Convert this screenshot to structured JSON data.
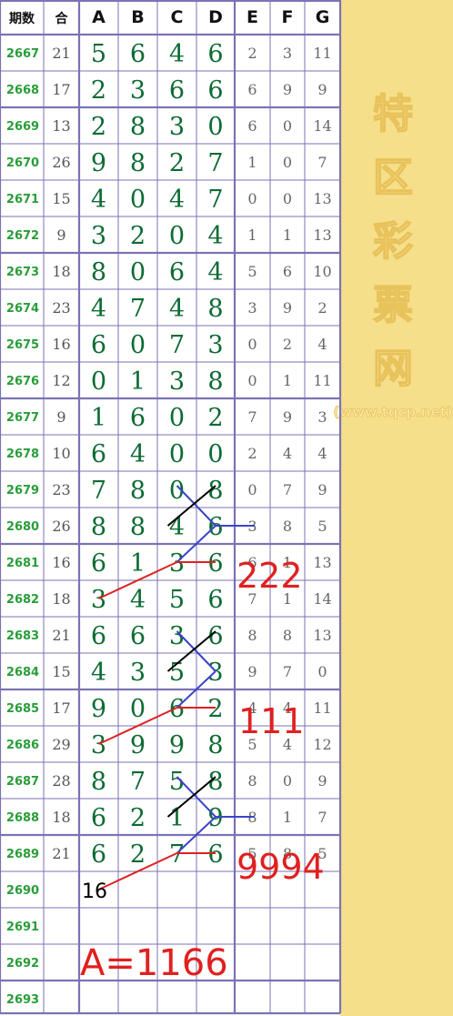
{
  "chart_data": {
    "type": "table",
    "columns": [
      "期数",
      "合",
      "A",
      "B",
      "C",
      "D",
      "E",
      "F",
      "G"
    ],
    "rows": [
      [
        "2667",
        "21",
        "5",
        "6",
        "4",
        "6",
        "2",
        "3",
        "11"
      ],
      [
        "2668",
        "17",
        "2",
        "3",
        "6",
        "6",
        "6",
        "9",
        "9"
      ],
      [
        "2669",
        "13",
        "2",
        "8",
        "3",
        "0",
        "6",
        "0",
        "14"
      ],
      [
        "2670",
        "26",
        "9",
        "8",
        "2",
        "7",
        "1",
        "0",
        "7"
      ],
      [
        "2671",
        "15",
        "4",
        "0",
        "4",
        "7",
        "0",
        "0",
        "13"
      ],
      [
        "2672",
        "9",
        "3",
        "2",
        "0",
        "4",
        "1",
        "1",
        "13"
      ],
      [
        "2673",
        "18",
        "8",
        "0",
        "6",
        "4",
        "5",
        "6",
        "10"
      ],
      [
        "2674",
        "23",
        "4",
        "7",
        "4",
        "8",
        "3",
        "9",
        "2"
      ],
      [
        "2675",
        "16",
        "6",
        "0",
        "7",
        "3",
        "0",
        "2",
        "4"
      ],
      [
        "2676",
        "12",
        "0",
        "1",
        "3",
        "8",
        "0",
        "1",
        "11"
      ],
      [
        "2677",
        "9",
        "1",
        "6",
        "0",
        "2",
        "7",
        "9",
        "3"
      ],
      [
        "2678",
        "10",
        "6",
        "4",
        "0",
        "0",
        "2",
        "4",
        "4"
      ],
      [
        "2679",
        "23",
        "7",
        "8",
        "0",
        "8",
        "0",
        "7",
        "9"
      ],
      [
        "2680",
        "26",
        "8",
        "8",
        "4",
        "6",
        "3",
        "8",
        "5"
      ],
      [
        "2681",
        "16",
        "6",
        "1",
        "3",
        "6",
        "6",
        "1",
        "13"
      ],
      [
        "2682",
        "18",
        "3",
        "4",
        "5",
        "6",
        "7",
        "1",
        "14"
      ],
      [
        "2683",
        "21",
        "6",
        "6",
        "3",
        "6",
        "8",
        "8",
        "13"
      ],
      [
        "2684",
        "15",
        "4",
        "3",
        "5",
        "3",
        "9",
        "7",
        "0"
      ],
      [
        "2685",
        "17",
        "9",
        "0",
        "6",
        "2",
        "4",
        "4",
        "11"
      ],
      [
        "2686",
        "29",
        "3",
        "9",
        "9",
        "8",
        "5",
        "4",
        "12"
      ],
      [
        "2687",
        "28",
        "8",
        "7",
        "5",
        "8",
        "8",
        "0",
        "9"
      ],
      [
        "2688",
        "18",
        "6",
        "2",
        "1",
        "9",
        "8",
        "1",
        "7"
      ],
      [
        "2689",
        "21",
        "6",
        "2",
        "7",
        "6",
        "5",
        "8",
        "5"
      ],
      [
        "2690",
        "",
        "",
        "",
        "",
        "",
        "",
        "",
        ""
      ],
      [
        "2691",
        "",
        "",
        "",
        "",
        "",
        "",
        "",
        ""
      ],
      [
        "2692",
        "",
        "",
        "",
        "",
        "",
        "",
        "",
        ""
      ],
      [
        "2693",
        "",
        "",
        "",
        "",
        "",
        "",
        "",
        ""
      ]
    ],
    "annotations": {
      "label_2681": "222",
      "label_2685": "111",
      "label_2689": "9994",
      "predicted_2690": "16",
      "formula": "A=1166"
    }
  },
  "watermark": {
    "characters": [
      "特",
      "区",
      "彩",
      "票",
      "网"
    ],
    "url": "(www.tqcp.net)"
  },
  "colors": {
    "big_digit": "#0d6b33",
    "period": "#2a9d3a",
    "grid_border": "#7a73b5",
    "side_panel": "#f6df8a",
    "red_line": "#e02020",
    "blue_line": "#3a44c8"
  }
}
